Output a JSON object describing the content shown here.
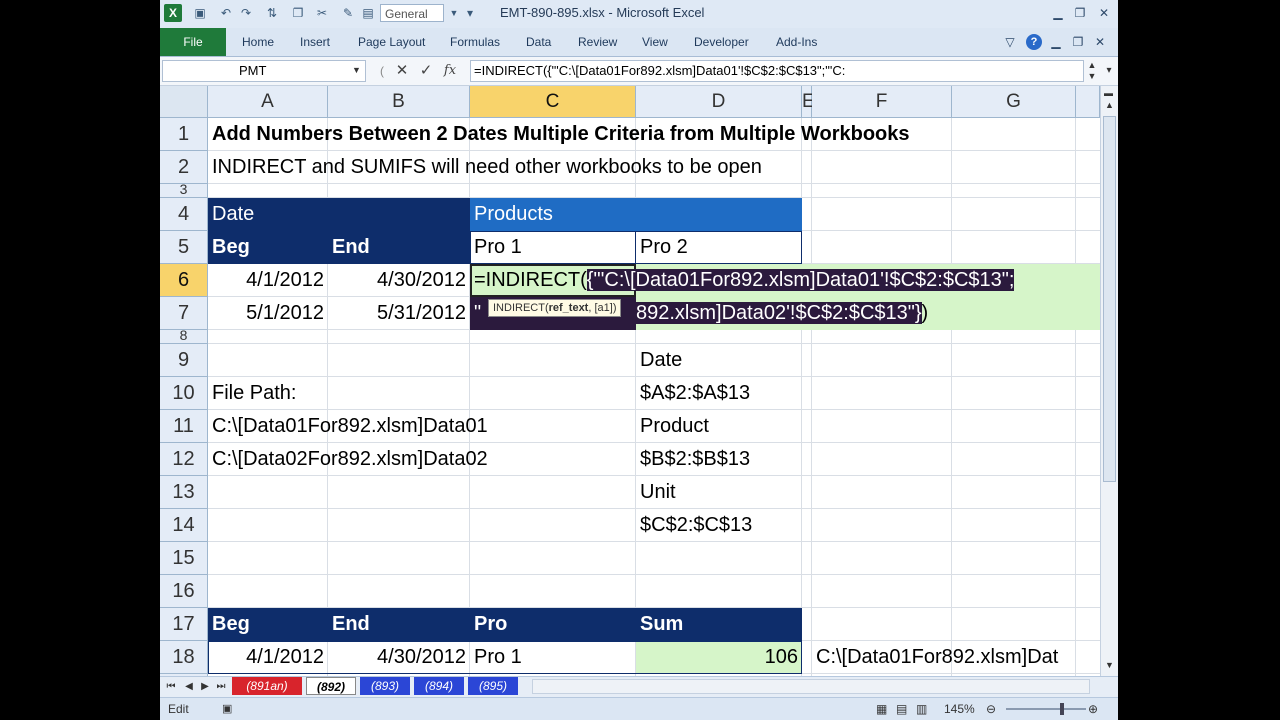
{
  "window": {
    "title": "EMT-890-895.xlsx  -  Microsoft Excel",
    "qat_format": "General",
    "app_icon": "X"
  },
  "ribbon": {
    "file_tab": "File",
    "tabs": [
      "Home",
      "Insert",
      "Page Layout",
      "Formulas",
      "Data",
      "Review",
      "View",
      "Developer",
      "Add-Ins"
    ]
  },
  "formula_bar": {
    "name_box": "PMT",
    "fx_label": "fx",
    "formula": "=INDIRECT({\"'C:\\[Data01For892.xlsm]Data01'!$C$2:$C$13\";\"'C:"
  },
  "columns": [
    "A",
    "B",
    "C",
    "D",
    "E",
    "F",
    "G"
  ],
  "rows": [
    "1",
    "2",
    "3",
    "4",
    "5",
    "6",
    "7",
    "8",
    "9",
    "10",
    "11",
    "12",
    "13",
    "14",
    "15",
    "16",
    "17",
    "18"
  ],
  "cells": {
    "A1": "Add Numbers Between 2 Dates Multiple Criteria from Multiple Workbooks",
    "A2": "INDIRECT and SUMIFS will need other workbooks to be open",
    "A4": "Date",
    "C4": "Products",
    "A5": "Beg",
    "B5": "End",
    "C5": "Pro 1",
    "D5": "Pro 2",
    "A6": "4/1/2012",
    "B6": "4/30/2012",
    "A7": "5/1/2012",
    "B7": "5/31/2012",
    "D9": "Date",
    "A10": "File Path:",
    "D10": "$A$2:$A$13",
    "A11": "C:\\[Data01For892.xlsm]Data01",
    "D11": "Product",
    "A12": "C:\\[Data02For892.xlsm]Data02",
    "D12": "$B$2:$B$13",
    "D13": "Unit",
    "D14": "$C$2:$C$13",
    "A17": "Beg",
    "B17": "End",
    "C17": "Pro",
    "D17": "Sum",
    "A18": "4/1/2012",
    "B18": "4/30/2012",
    "C18": "Pro 1",
    "D18": "106",
    "F18": "C:\\[Data01For892.xlsm]Dat"
  },
  "edit": {
    "line1_prefix": "=INDIRECT(",
    "line1_sel": "{\"'C:\\[Data01For892.xlsm]Data01'!$C$2:$C$13\";",
    "line2_q": "\"",
    "line2_sel": "892.xlsm]Data02'!$C$2:$C$13\"}",
    "line2_close": ")",
    "tooltip_func": "INDIRECT(",
    "tooltip_arg": "ref_text",
    "tooltip_rest": ", [a1])"
  },
  "sheets": [
    "(891an)",
    "(892)",
    "(893)",
    "(894)",
    "(895)"
  ],
  "active_sheet": "(892)",
  "status": {
    "mode": "Edit",
    "zoom": "145%"
  },
  "colors": {
    "header_fill": "#0e2d6b",
    "products_fill": "#1f6cc4",
    "active_header": "#f8d36b",
    "highlight_green": "#d6f5c9",
    "selection": "#2b1a3d",
    "excel_green": "#1f7a3a"
  }
}
